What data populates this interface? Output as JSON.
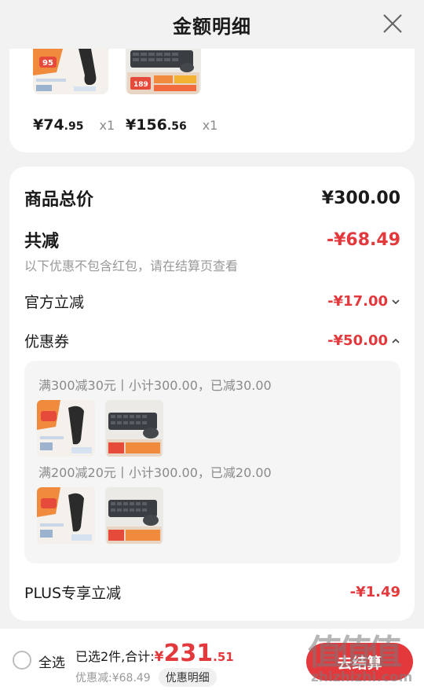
{
  "header": {
    "title": "金额明细"
  },
  "products": [
    {
      "name": "scanner",
      "price_int": "¥74",
      "price_dec": ".95",
      "qty": "x1"
    },
    {
      "name": "keyboard",
      "price_int": "¥156",
      "price_dec": ".56",
      "qty": "x1"
    }
  ],
  "summary": {
    "total_label": "商品总价",
    "total_value": "¥300.00",
    "reduce_label": "共减",
    "reduce_value": "-¥68.49",
    "reduce_note": "以下优惠不包含红包，请在结算页查看",
    "official_label": "官方立减",
    "official_value": "-¥17.00",
    "coupon_label": "优惠券",
    "coupon_value": "-¥50.00",
    "plus_label": "PLUS专享立减",
    "plus_value": "-¥1.49"
  },
  "coupons": [
    {
      "line": "满300减30元丨小计300.00，已减30.00"
    },
    {
      "line": "满200减20元丨小计300.00，已减20.00"
    }
  ],
  "thumb_text": {
    "scanner_badge": "95",
    "keyboard_price": "189"
  },
  "footer": {
    "select_all": "全选",
    "selected": "已选2件,合计:",
    "yen": "¥",
    "total_int": "231",
    "total_dec": ".51",
    "discount": "优惠减:¥68.49",
    "discount_btn": "优惠明细",
    "checkout": "去结算"
  },
  "watermark": {
    "logo": "值",
    "site": "zhizhizhi.com"
  },
  "colors": {
    "accent": "#e4393c",
    "bg": "#f2f2f2"
  }
}
